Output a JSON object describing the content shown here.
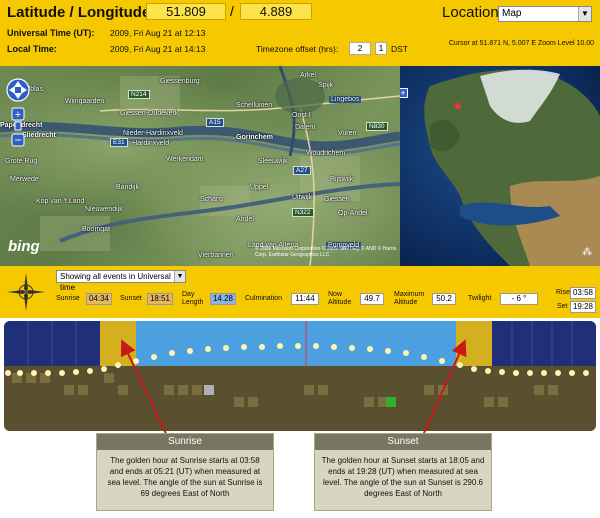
{
  "header": {
    "title": "Latitude / Longitude",
    "latitude": "51.809",
    "slash": "/",
    "longitude": "4.889",
    "location_label": "Location",
    "location_value": "Map",
    "utc_label": "Universal Time (UT):",
    "utc_value": "2009, Fri Aug 21 at 12:13",
    "local_label": "Local Time:",
    "local_value": "2009, Fri Aug 21 at 14:13",
    "tz_label": "Timezone offset (hrs):",
    "tz_value": "2",
    "dst_value": "1",
    "dst_label": "DST",
    "cursor_info": "Cursor at 51.871 N, 5.007 E Zoom Level 10.00"
  },
  "map": {
    "places": [
      "Arkel",
      "Spijk",
      "Lingebos",
      "Alblas",
      "Wijngaarden",
      "Giessenburg",
      "Giessen-Oudekerk",
      "Schelluinen",
      "Oost I",
      "Dalem",
      "Nieder-Hardinxveld",
      "Gorinchem",
      "Vuren",
      "Papendrecht",
      "Sliedrecht",
      "Boven-Hardinxveld",
      "Woudrichem",
      "Werkendam",
      "Sleeuwijk",
      "Grote Rug",
      "Bandijk",
      "Uppel",
      "Rijswijk",
      "Kop van 't Land",
      "Schans",
      "Nieuwendijk",
      "Uitwijk",
      "Giessen",
      "Andel",
      "Boomgat",
      "Op-Andel",
      "Land van Altena",
      "Pompveld",
      "Vierbannen",
      "Merwede"
    ],
    "roads": [
      "N214",
      "A15",
      "E31",
      "N830",
      "A27",
      "N322"
    ],
    "brand": "bing",
    "copyright": "© 2009 Microsoft Corporation © 2009 NAVTEQ © AND © Harris Corp, Earthstar Geographics LLC"
  },
  "controls": {
    "mode": "Showing all events in Universal time",
    "sunrise_label": "Sunrise",
    "sunrise_value": "04:34",
    "sunset_label": "Sunset",
    "sunset_value": "18:51",
    "day_length_label": "Day Length",
    "day_length_value": "14.28",
    "culmination_label": "Culmination",
    "culmination_value": "11:44",
    "now_alt_label": "Now Altitude",
    "now_alt_value": "49.7",
    "max_alt_label": "Maximum Altitude",
    "max_alt_value": "50.2",
    "twilight_label": "Twilight",
    "twilight_value": "- 6 °",
    "rise_label": "Rise",
    "rise_value": "03:58",
    "set_label": "Set",
    "set_value": "19:28"
  },
  "callouts": {
    "sunrise_title": "Sunrise",
    "sunrise_text": "The golden hour at Sunrise starts at 03:58 and ends at 05:21 (UT) when measured at sea level. The angle of the sun at Sunrise is 69 degrees East of North",
    "sunset_title": "Sunset",
    "sunset_text": "The golden hour at Sunset starts at 18:05 and ends at 19:28 (UT) when measured at sea level. The angle of the sun at Sunset is 290.6 degrees East of North"
  },
  "colors": {
    "header_bg": "#f5c800",
    "night": "#1f3078",
    "day": "#4da0e0",
    "golden": "#d4b020",
    "arrow": "#c81818"
  }
}
